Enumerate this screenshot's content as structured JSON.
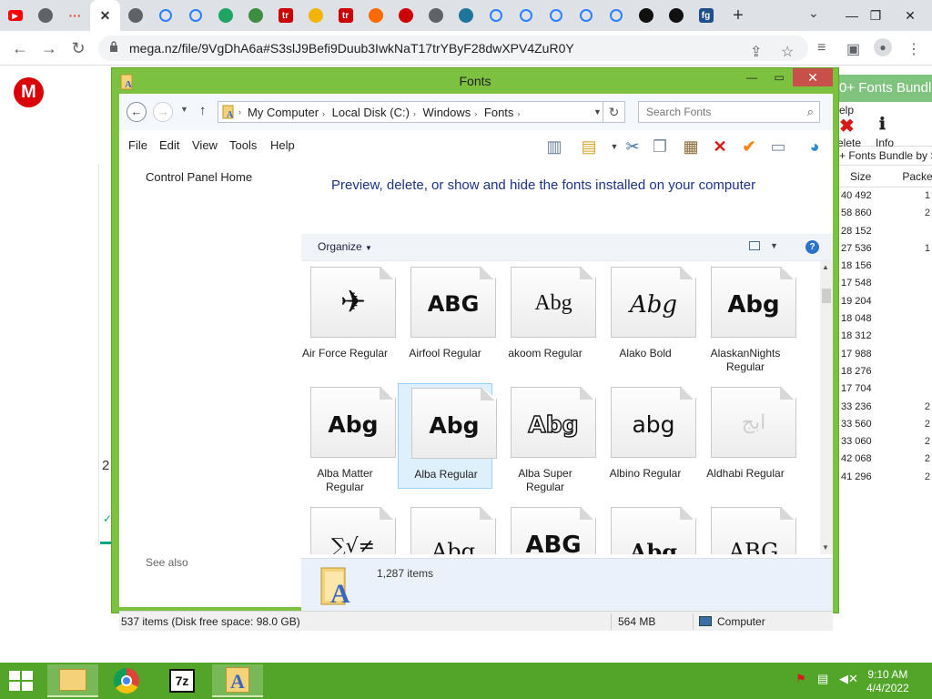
{
  "browser": {
    "tabs": [
      {
        "icon": "youtube-icon",
        "color": "#ff0000"
      },
      {
        "icon": "history-icon",
        "color": "#5f6368"
      },
      {
        "icon": "loading-dots-icon",
        "color": "#e34234"
      },
      {
        "icon": "close-icon",
        "color": "#333333"
      },
      {
        "icon": "globe-icon",
        "color": "#5f6368"
      },
      {
        "icon": "mega-sync-icon",
        "color": "#2c80ff"
      },
      {
        "icon": "mega-sync-icon",
        "color": "#2c80ff"
      },
      {
        "icon": "google-drive-icon",
        "color": "#1fa463"
      },
      {
        "icon": "globe-flag-icon",
        "color": "#3e8e41"
      },
      {
        "icon": "tr-icon",
        "color": "#cc0000",
        "text": "tr"
      },
      {
        "icon": "glasses-icon",
        "color": "#f2b400"
      },
      {
        "icon": "tr-icon",
        "color": "#cc0000",
        "text": "tr"
      },
      {
        "icon": "orange-ball-icon",
        "color": "#ff6a00"
      },
      {
        "icon": "magazine-icon",
        "color": "#cc0000"
      },
      {
        "icon": "globe-icon",
        "color": "#5f6368"
      },
      {
        "icon": "wordpress-icon",
        "color": "#21759b"
      },
      {
        "icon": "mega-sync-icon",
        "color": "#2c80ff"
      },
      {
        "icon": "mega-sync-icon",
        "color": "#2c80ff"
      },
      {
        "icon": "mega-sync-icon",
        "color": "#2c80ff"
      },
      {
        "icon": "mega-sync-icon",
        "color": "#2c80ff"
      },
      {
        "icon": "mega-sync-icon",
        "color": "#2c80ff"
      },
      {
        "icon": "swirl-icon",
        "color": "#111111"
      },
      {
        "icon": "swirl-icon",
        "color": "#111111"
      },
      {
        "icon": "fg-icon",
        "color": "#1f4e8c",
        "text": "fg"
      }
    ],
    "url": "mega.nz/file/9VgDhA6a#S3slJ9Befi9Duub3IwkNaT17trYByF28dwXPV4ZuR0Y"
  },
  "background_window": {
    "title": "0+ Fonts Bundle",
    "menu_fragment": "elp",
    "tools": [
      "elete",
      "Info"
    ],
    "path": "+ Fonts Bundle by S",
    "columns": [
      "Size",
      "Packe"
    ],
    "sizes": [
      "40 492",
      "58 860",
      "28 152",
      "27 536",
      "18 156",
      "17 548",
      "19 204",
      "18 048",
      "18 312",
      "17 988",
      "18 276",
      "17 704",
      "33 236",
      "33 560",
      "33 060",
      "42 068",
      "41 296"
    ],
    "packed_digits": [
      "1",
      "2",
      "",
      "1",
      "",
      "",
      "",
      "",
      "",
      "",
      "",
      "",
      "2",
      "2",
      "2",
      "2",
      "2"
    ]
  },
  "mega": {
    "logo": "M",
    "fragment_text": "2"
  },
  "explorer": {
    "title": "Fonts",
    "breadcrumbs": [
      "My Computer",
      "Local Disk (C:)",
      "Windows",
      "Fonts"
    ],
    "search_placeholder": "Search Fonts",
    "menu": [
      "File",
      "Edit",
      "View",
      "Tools",
      "Help"
    ],
    "left_pane": {
      "control_panel_home": "Control Panel Home",
      "see_also": "See also"
    },
    "heading": "Preview, delete, or show and hide the fonts installed on your computer",
    "organize_label": "Organize",
    "fonts": [
      {
        "name": "Air Force Regular",
        "sample": "✈",
        "style": "jet",
        "selected": false
      },
      {
        "name": "Airfool Regular",
        "sample": "ABG",
        "style": "blackletter",
        "selected": false
      },
      {
        "name": "akoom Regular",
        "sample": "Abg",
        "style": "light",
        "selected": false
      },
      {
        "name": "Alako Bold",
        "sample": "Abg",
        "style": "script",
        "selected": false
      },
      {
        "name": "AlaskanNights Regular",
        "sample": "Abg",
        "style": "bold",
        "selected": false
      },
      {
        "name": "Alba Matter Regular",
        "sample": "Abg",
        "style": "rounded",
        "selected": false
      },
      {
        "name": "Alba Regular",
        "sample": "Abg",
        "style": "rounded",
        "selected": true
      },
      {
        "name": "Alba Super Regular",
        "sample": "Abg",
        "style": "outline",
        "selected": false
      },
      {
        "name": "Albino Regular",
        "sample": "abg",
        "style": "normal",
        "selected": false
      },
      {
        "name": "Aldhabi Regular",
        "sample": "ابج",
        "style": "faint",
        "selected": false
      },
      {
        "name": "",
        "sample": "∑√≠",
        "style": "math",
        "selected": false
      },
      {
        "name": "",
        "sample": "Abg",
        "style": "serif",
        "selected": false
      },
      {
        "name": "",
        "sample": "ABG",
        "style": "bold",
        "selected": false
      },
      {
        "name": "",
        "sample": "Abg",
        "style": "heavyserif",
        "selected": false
      },
      {
        "name": "",
        "sample": "ABG",
        "style": "serif",
        "selected": false
      }
    ],
    "details_count": "1,287 items",
    "status": {
      "items": "537 items (Disk free space: 98.0 GB)",
      "size": "564 MB",
      "location": "Computer"
    }
  },
  "taskbar": {
    "apps": [
      {
        "icon": "file-explorer-icon",
        "open": true
      },
      {
        "icon": "chrome-icon",
        "open": false
      },
      {
        "icon": "7zip-icon",
        "open": false,
        "text": "7z"
      },
      {
        "icon": "fonts-folder-icon",
        "open": true
      }
    ],
    "time": "9:10 AM",
    "date": "4/4/2022"
  }
}
